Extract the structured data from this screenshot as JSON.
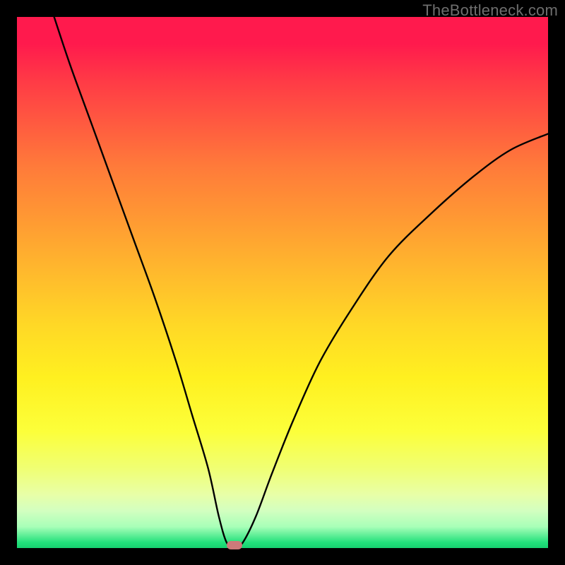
{
  "watermark": "TheBottleneck.com",
  "chart_data": {
    "type": "line",
    "title": "",
    "xlabel": "",
    "ylabel": "",
    "xlim": [
      0,
      100
    ],
    "ylim": [
      0,
      100
    ],
    "grid": false,
    "legend": false,
    "series": [
      {
        "name": "bottleneck-curve",
        "x": [
          7,
          10,
          14,
          18,
          22,
          26,
          30,
          33,
          36,
          38,
          39.5,
          41,
          42.5,
          45,
          48,
          52,
          57,
          63,
          70,
          78,
          86,
          93,
          100
        ],
        "values": [
          100,
          91,
          80,
          69,
          58,
          47,
          35,
          25,
          15,
          6,
          1,
          0,
          1,
          6,
          14,
          24,
          35,
          45,
          55,
          63,
          70,
          75,
          78
        ]
      }
    ],
    "marker": {
      "x": 41,
      "y": 0
    },
    "background_gradient": {
      "top": "#ff1a4d",
      "mid": "#ffd826",
      "bottom": "#18d070"
    },
    "border_color": "#000000"
  }
}
